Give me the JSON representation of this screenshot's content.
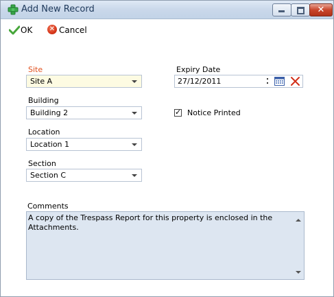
{
  "window": {
    "title": "Add New Record",
    "icon": "add-record-icon",
    "controls": [
      "minimize-icon",
      "maximize-icon",
      "close-icon"
    ]
  },
  "toolbar": {
    "ok_label": "OK",
    "cancel_label": "Cancel"
  },
  "form": {
    "site": {
      "label": "Site",
      "value": "Site A",
      "required": true
    },
    "building": {
      "label": "Building",
      "value": "Building 2"
    },
    "location": {
      "label": "Location",
      "value": "Location 1"
    },
    "section": {
      "label": "Section",
      "value": "Section C"
    },
    "expiry": {
      "label": "Expiry Date",
      "value": "27/12/2011"
    },
    "notice_printed": {
      "label": "Notice Printed",
      "checked": true
    },
    "comments": {
      "label": "Comments",
      "value": "A copy of the Trespass Report for this property is enclosed in the Attachments."
    }
  },
  "colors": {
    "required_label": "#e0501e",
    "memo_background": "#dde6f1",
    "highlight_field": "#fdfbe2"
  }
}
